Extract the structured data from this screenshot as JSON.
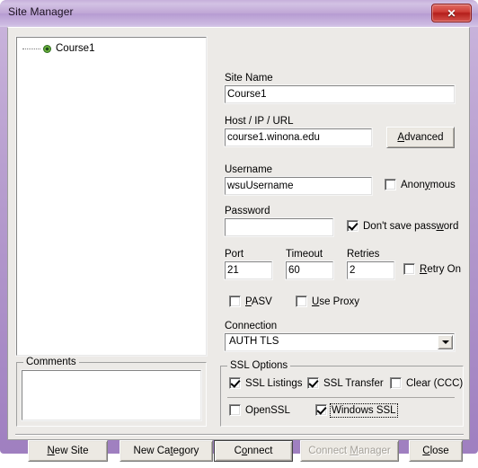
{
  "window": {
    "title": "Site Manager",
    "close_label": "✕",
    "accent_purple": "#b79cd2",
    "close_red": "#cf3f38",
    "client_bg": "#eceae7"
  },
  "tree": {
    "nodes": [
      {
        "label": "Course1",
        "icon": "site-node-icon"
      }
    ]
  },
  "comments": {
    "group_title": "Comments",
    "value": "",
    "placeholder": ""
  },
  "form": {
    "site_name": {
      "label": "Site Name",
      "value": "Course1",
      "placeholder": ""
    },
    "host": {
      "label": "Host / IP / URL",
      "value": "course1.winona.edu",
      "placeholder": ""
    },
    "advanced_button": {
      "label": "Advanced",
      "accel": "A"
    },
    "username": {
      "label": "Username",
      "value": "wsuUsername",
      "placeholder": ""
    },
    "anonymous": {
      "label": "Anonymous",
      "accel": "y",
      "checked": false
    },
    "password": {
      "label": "Password",
      "value": "",
      "placeholder": ""
    },
    "dont_save_password": {
      "label": "Don't save password",
      "accel": "w",
      "checked": true
    },
    "port": {
      "label": "Port",
      "value": "21"
    },
    "timeout": {
      "label": "Timeout",
      "value": "60"
    },
    "retries": {
      "label": "Retries",
      "value": "2"
    },
    "retry_on": {
      "label": "Retry On",
      "accel": "R",
      "checked": false
    },
    "pasv": {
      "label": "PASV",
      "accel": "P",
      "checked": false
    },
    "use_proxy": {
      "label": "Use Proxy",
      "accel": "U",
      "checked": false
    },
    "connection": {
      "label": "Connection",
      "value": "AUTH TLS",
      "options": [
        "AUTH TLS"
      ]
    }
  },
  "ssl_options": {
    "group_title": "SSL Options",
    "items": [
      {
        "label": "SSL Listings",
        "checked": true,
        "focused": false
      },
      {
        "label": "SSL Transfer",
        "checked": true,
        "focused": false
      },
      {
        "label": "Clear (CCC)",
        "checked": false,
        "focused": false
      },
      {
        "label": "OpenSSL",
        "checked": false,
        "focused": false
      },
      {
        "label": "Windows SSL",
        "checked": true,
        "focused": true
      }
    ]
  },
  "buttons": [
    {
      "label": "New Site",
      "accel": "N",
      "disabled": false,
      "default": false
    },
    {
      "label": "New Category",
      "accel": "t",
      "disabled": false,
      "default": false
    },
    {
      "label": "Connect",
      "accel": "o",
      "disabled": false,
      "default": true
    },
    {
      "label": "Connect Manager",
      "accel": "M",
      "disabled": true,
      "default": false
    },
    {
      "label": "Close",
      "accel": "C",
      "disabled": false,
      "default": false
    }
  ]
}
